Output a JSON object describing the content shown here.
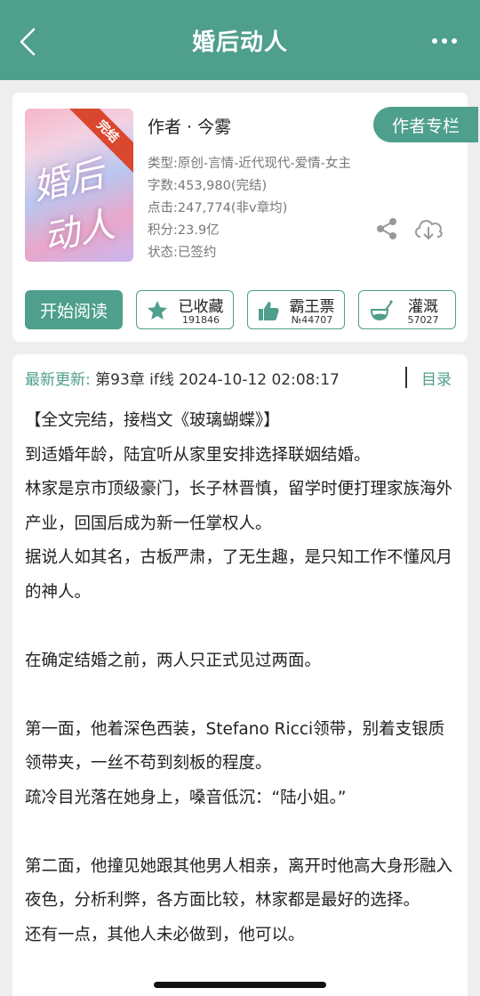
{
  "nav": {
    "title": "婚后动人",
    "back_icon": "chevron-left-icon",
    "more_icon": "more-horizontal-icon",
    "color": "#4e9f8c"
  },
  "book": {
    "cover_badge": "完结",
    "author": "作者 · 今雾",
    "author_button": "作者专栏",
    "meta": {
      "type": "类型:原创-言情-近代现代-爱情-女主",
      "words": "字数:453,980(完结)",
      "clicks": "点击:247,774(非v章均)",
      "score": "积分:23.9亿",
      "status": "状态:已签约"
    }
  },
  "actions": {
    "read": "开始阅读",
    "collect": {
      "label": "已收藏",
      "count": "191846",
      "icon": "star-icon"
    },
    "ticket": {
      "label": "霸王票",
      "count": "№44707",
      "icon": "thumbs-up-icon"
    },
    "water": {
      "label": "灌溉",
      "count": "57027",
      "icon": "watering-can-icon"
    }
  },
  "content": {
    "update_label": "最新更新:",
    "update_text": " 第93章 if线 2024-10-12 02:08:17",
    "toc": "目录",
    "paragraphs": [
      "【全文完结，接档文《玻璃蝴蝶》】",
      "到适婚年龄，陆宜听从家里安排选择联姻结婚。",
      "林家是京市顶级豪门，长子林晋慎，留学时便打理家族海外产业，回国后成为新一任掌权人。",
      "据说人如其名，古板严肃，了无生趣，是只知工作不懂风月的神人。",
      "",
      "在确定结婚之前，两人只正式见过两面。",
      "",
      "第一面，他着深色西装，Stefano Ricci领带，别着支银质领带夹，一丝不苟到刻板的程度。",
      "疏冷目光落在她身上，嗓音低沉：“陆小姐。”",
      "",
      "第二面，他撞见她跟其他男人相亲，离开时他高大身形融入夜色，分析利弊，各方面比较，林家都是最好的选择。",
      "还有一点，其他人未必做到，他可以。"
    ]
  }
}
